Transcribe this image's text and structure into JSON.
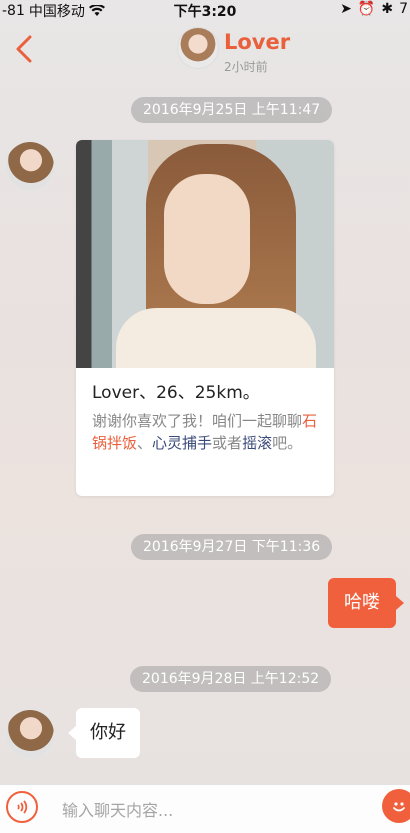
{
  "status_bar": {
    "signal": "-81",
    "carrier": "中国移动",
    "time": "下午3:20",
    "battery": "7"
  },
  "header": {
    "name": "Lover",
    "subtitle": "2小时前"
  },
  "messages": [
    {
      "type": "timestamp",
      "text": "2016年9月25日 上午11:47"
    },
    {
      "type": "profile-card",
      "title": "Lover、26、25km。",
      "desc_parts": [
        {
          "text": "谢谢你喜欢了我！咱们一起聊聊",
          "style": "normal"
        },
        {
          "text": "石锅拌饭",
          "style": "red"
        },
        {
          "text": "、",
          "style": "normal"
        },
        {
          "text": "心灵捕手",
          "style": "blue"
        },
        {
          "text": "或者",
          "style": "normal"
        },
        {
          "text": "摇滚",
          "style": "blue"
        },
        {
          "text": "吧。",
          "style": "normal"
        }
      ]
    },
    {
      "type": "timestamp",
      "text": "2016年9月27日 下午11:36"
    },
    {
      "type": "outgoing",
      "text": "哈喽"
    },
    {
      "type": "timestamp",
      "text": "2016年9月28日 上午12:52"
    },
    {
      "type": "incoming",
      "text": "你好"
    }
  ],
  "input": {
    "placeholder": "输入聊天内容..."
  },
  "colors": {
    "accent": "#f0603c",
    "highlight_red": "#e8603c",
    "highlight_blue": "#3a4a7a"
  }
}
